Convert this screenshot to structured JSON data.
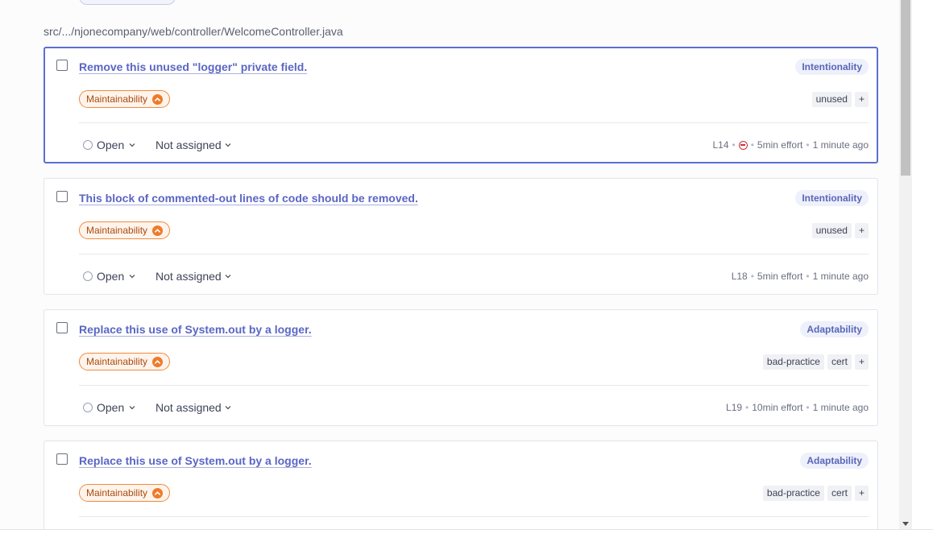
{
  "file_path": "src/.../njonecompany/web/controller/WelcomeController.java",
  "colors": {
    "link": "#5a66c4",
    "selected_border": "#5d6fd0",
    "maintainability": "#ee7a2a",
    "blocker": "#d02f3a"
  },
  "issues": [
    {
      "title": "Remove this unused \"logger\" private field.",
      "attribute": "Intentionality",
      "quality": "Maintainability",
      "severity_icon": "chevron-up-icon",
      "tags": [
        "unused"
      ],
      "add_tag": "+",
      "status": "Open",
      "assignee": "Not assigned",
      "line": "L14",
      "effort": "5min effort",
      "age": "1 minute ago",
      "selected": true,
      "blocker": true
    },
    {
      "title": "This block of commented-out lines of code should be removed.",
      "attribute": "Intentionality",
      "quality": "Maintainability",
      "severity_icon": "chevron-up-icon",
      "tags": [
        "unused"
      ],
      "add_tag": "+",
      "status": "Open",
      "assignee": "Not assigned",
      "line": "L18",
      "effort": "5min effort",
      "age": "1 minute ago",
      "selected": false,
      "blocker": false
    },
    {
      "title": "Replace this use of System.out by a logger.",
      "attribute": "Adaptability",
      "quality": "Maintainability",
      "severity_icon": "chevron-up-icon",
      "tags": [
        "bad-practice",
        "cert"
      ],
      "add_tag": "+",
      "status": "Open",
      "assignee": "Not assigned",
      "line": "L19",
      "effort": "10min effort",
      "age": "1 minute ago",
      "selected": false,
      "blocker": false
    },
    {
      "title": "Replace this use of System.out by a logger.",
      "attribute": "Adaptability",
      "quality": "Maintainability",
      "severity_icon": "chevron-up-icon",
      "tags": [
        "bad-practice",
        "cert"
      ],
      "add_tag": "+",
      "selected": false,
      "blocker": false
    }
  ]
}
